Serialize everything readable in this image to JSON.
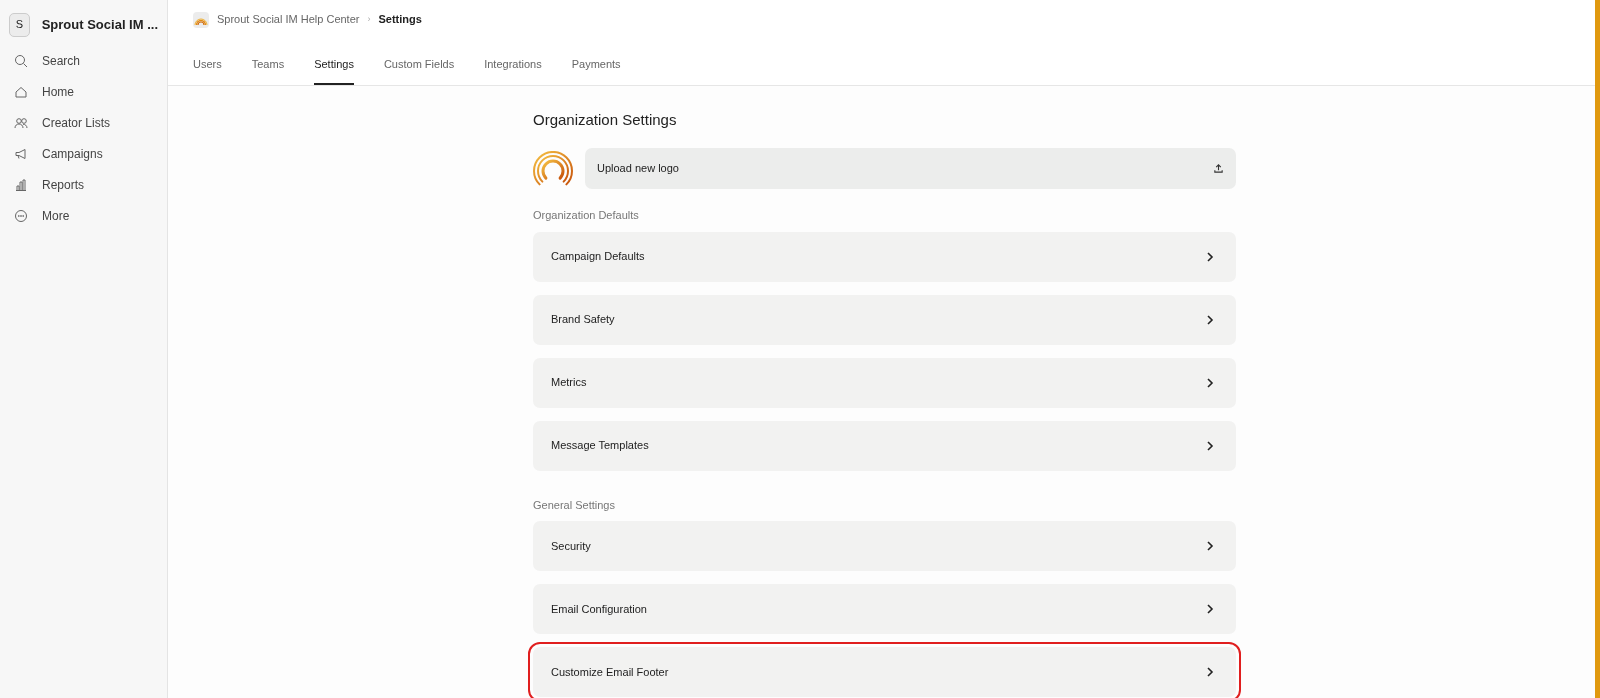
{
  "sidebar": {
    "workspace_initial": "S",
    "workspace_name": "Sprout Social IM ...",
    "items": [
      {
        "kind": "search",
        "label": "Search"
      },
      {
        "kind": "home",
        "label": "Home"
      },
      {
        "kind": "people",
        "label": "Creator Lists"
      },
      {
        "kind": "megaphone",
        "label": "Campaigns"
      },
      {
        "kind": "chart",
        "label": "Reports"
      },
      {
        "kind": "more",
        "label": "More"
      }
    ]
  },
  "breadcrumb": {
    "parent": "Sprout Social IM Help Center",
    "separator": "›",
    "current": "Settings"
  },
  "tabs": [
    {
      "label": "Users",
      "selected": false
    },
    {
      "label": "Teams",
      "selected": false
    },
    {
      "label": "Settings",
      "selected": true
    },
    {
      "label": "Custom Fields",
      "selected": false
    },
    {
      "label": "Integrations",
      "selected": false
    },
    {
      "label": "Payments",
      "selected": false
    }
  ],
  "page_title": "Organization Settings",
  "upload": {
    "label": "Upload new logo"
  },
  "sections": [
    {
      "title": "Organization Defaults",
      "rows": [
        {
          "label": "Campaign Defaults",
          "highlighted": false
        },
        {
          "label": "Brand Safety",
          "highlighted": false
        },
        {
          "label": "Metrics",
          "highlighted": false
        },
        {
          "label": "Message Templates",
          "highlighted": false
        }
      ]
    },
    {
      "title": "General Settings",
      "rows": [
        {
          "label": "Security",
          "highlighted": false
        },
        {
          "label": "Email Configuration",
          "highlighted": false
        },
        {
          "label": "Customize Email Footer",
          "highlighted": true
        }
      ]
    }
  ]
}
